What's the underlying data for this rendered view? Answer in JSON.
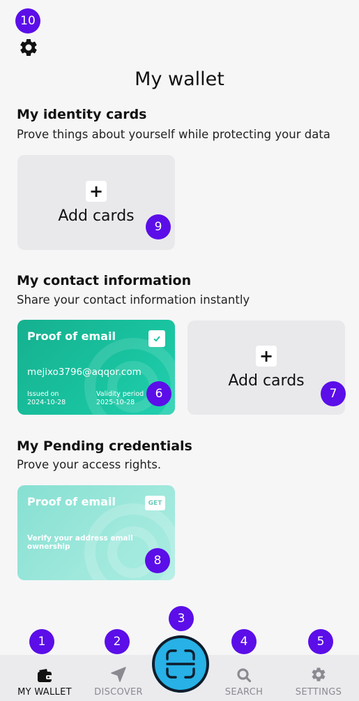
{
  "page": {
    "title": "My wallet"
  },
  "badges": [
    "1",
    "2",
    "3",
    "4",
    "5",
    "6",
    "7",
    "8",
    "9",
    "10"
  ],
  "identity": {
    "title": "My identity cards",
    "subtitle": "Prove things about yourself while protecting your data",
    "add_label": "Add cards"
  },
  "contact": {
    "title": "My contact information",
    "subtitle": "Share your contact information instantly",
    "card": {
      "title": "Proof of email",
      "email": "mejixo3796@aqqor.com",
      "issued_label": "Issued on",
      "issued_value": "2024-10-28",
      "validity_label": "Validity period",
      "validity_value": "2025-10-28"
    },
    "add_label": "Add cards"
  },
  "pending": {
    "title": "My Pending credentials",
    "subtitle": "Prove your access rights.",
    "card": {
      "title": "Proof of email",
      "action": "GET",
      "description": "Verify your address email ownership"
    }
  },
  "nav": {
    "wallet": "MY WALLET",
    "discover": "DISCOVER",
    "search": "SEARCH",
    "settings": "SETTINGS"
  },
  "colors": {
    "accent": "#5b0ee8",
    "scan": "#27b1e6",
    "card_green": "#19c3a0",
    "card_pending": "#9fe8dc"
  },
  "icons": {
    "top": "gear-icon",
    "wallet": "wallet-icon",
    "discover": "navigation-arrow-icon",
    "scan": "scan-frame-icon",
    "search": "search-icon",
    "settings": "gear-icon"
  }
}
